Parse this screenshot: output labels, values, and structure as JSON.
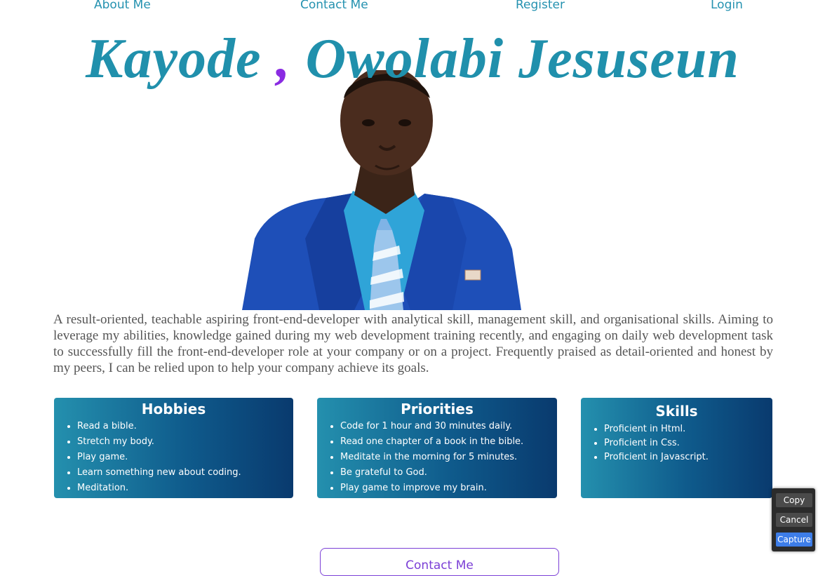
{
  "nav": {
    "about": "About Me",
    "contact": "Contact Me",
    "register": "Register",
    "login": "Login"
  },
  "hero": {
    "first_name": "Kayode",
    "separator": ",",
    "last_names": "Owolabi Jesuseun"
  },
  "bio": "A result-oriented, teachable aspiring front-end-developer with analytical skill, management skill, and organisational skills. Aiming to leverage my abilities, knowledge gained during my web development training recently, and engaging on daily web development task to successfully fill the front-end-developer role at your company or on a project. Frequently praised as detail-oriented and honest by my peers, I can be relied upon to help your company achieve its goals.",
  "hobbies": {
    "title": "Hobbies",
    "items": [
      "Read a bible.",
      "Stretch my body.",
      "Play game.",
      "Learn something new about coding.",
      "Meditation."
    ]
  },
  "priorities": {
    "title": "Priorities",
    "items": [
      "Code for 1 hour and 30 minutes daily.",
      "Read one chapter of a book in the bible.",
      "Meditate in the morning for 5 minutes.",
      "Be grateful to God.",
      "Play game to improve my brain."
    ]
  },
  "skills": {
    "title": "Skills",
    "items": [
      "Proficient in Html.",
      "Proficient in Css.",
      "Proficient in Javascript."
    ]
  },
  "contact_button": "Contact Me",
  "capture_menu": {
    "copy": "Copy",
    "cancel": "Cancel",
    "capture": "Capture"
  },
  "colors": {
    "accent": "#2090ac",
    "comma": "#8a2be2",
    "card_gradient_start": "#2490ae",
    "card_gradient_end": "#093a6e"
  }
}
